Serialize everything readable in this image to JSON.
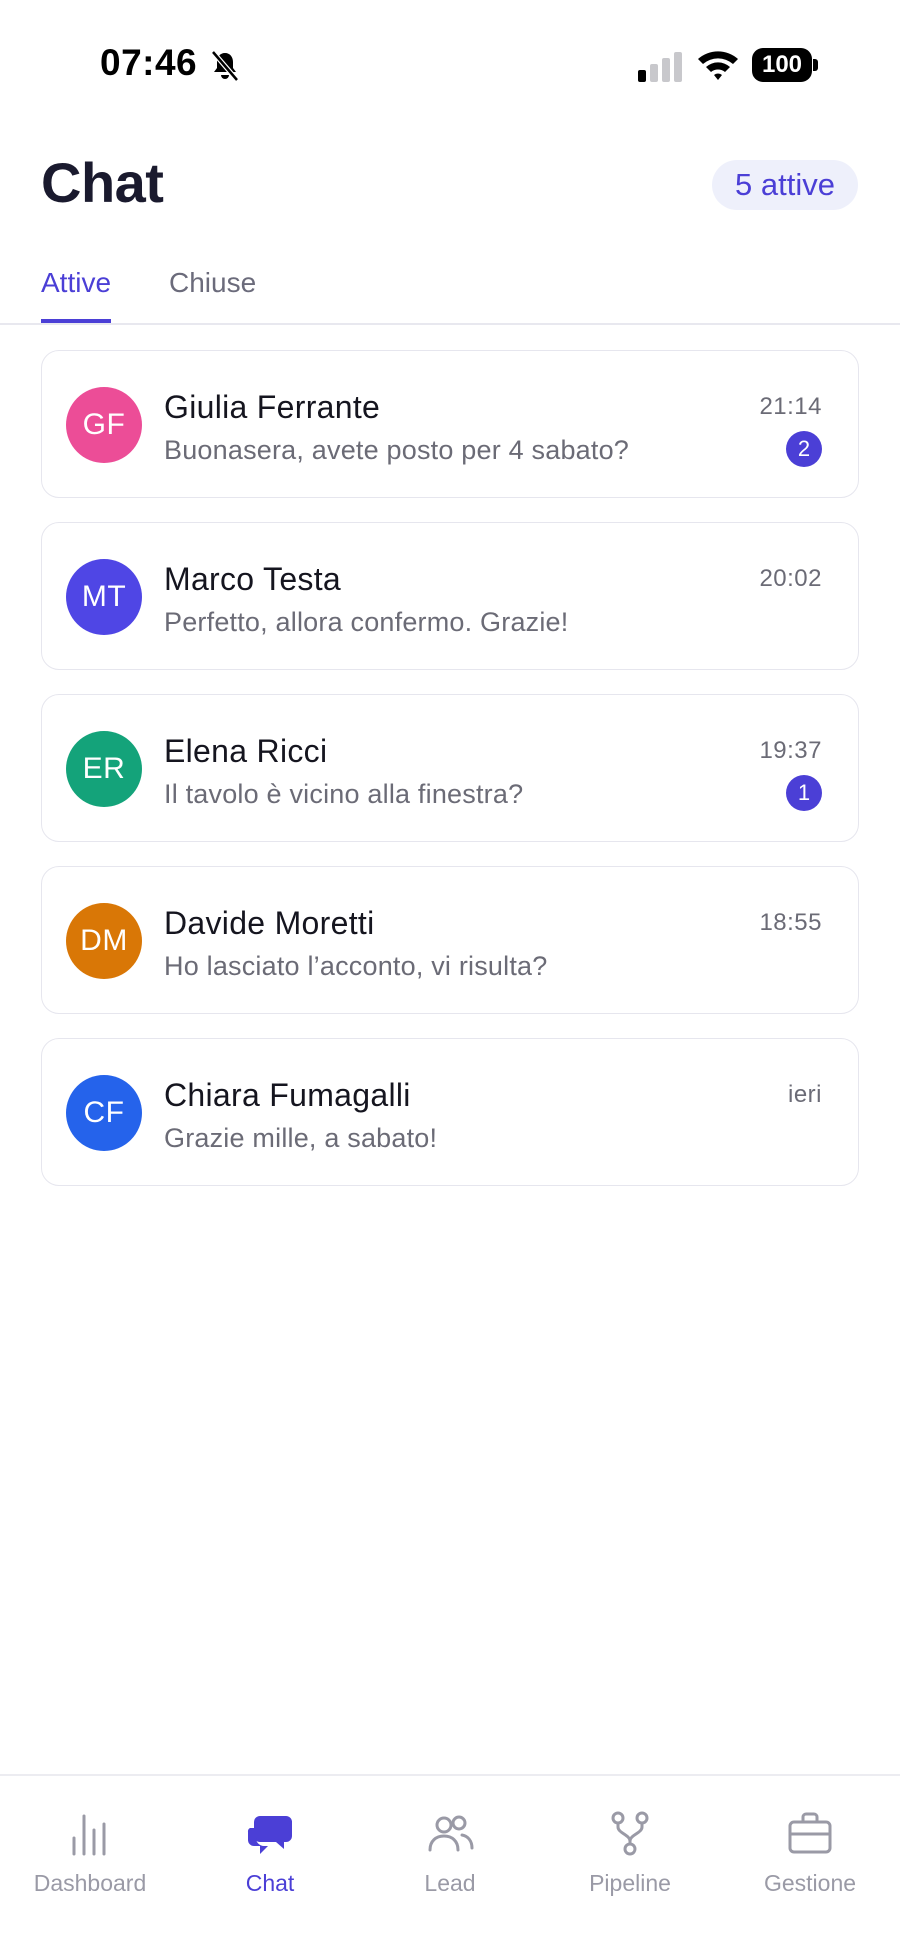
{
  "status_bar": {
    "time": "07:46",
    "battery": "100"
  },
  "header": {
    "title": "Chat",
    "active_pill": "5 attive"
  },
  "tabs": [
    {
      "label": "Attive",
      "active": true
    },
    {
      "label": "Chiuse",
      "active": false
    }
  ],
  "chats": [
    {
      "initials": "GF",
      "name": "Giulia Ferrante",
      "preview": "Buonasera, avete posto per 4 sabato?",
      "time": "21:14",
      "unread": "2",
      "avatar_color": "#ec4d97"
    },
    {
      "initials": "MT",
      "name": "Marco Testa",
      "preview": "Perfetto, allora confermo. Grazie!",
      "time": "20:02",
      "unread": "",
      "avatar_color": "#4f46e5"
    },
    {
      "initials": "ER",
      "name": "Elena Ricci",
      "preview": "Il tavolo è vicino alla finestra?",
      "time": "19:37",
      "unread": "1",
      "avatar_color": "#14a37a"
    },
    {
      "initials": "DM",
      "name": "Davide Moretti",
      "preview": "Ho lasciato l’acconto, vi risulta?",
      "time": "18:55",
      "unread": "",
      "avatar_color": "#d97706"
    },
    {
      "initials": "CF",
      "name": "Chiara Fumagalli",
      "preview": "Grazie mille, a sabato!",
      "time": "ieri",
      "unread": "",
      "avatar_color": "#2563eb"
    }
  ],
  "bottom_nav": [
    {
      "label": "Dashboard",
      "icon": "bar-chart-icon",
      "active": false
    },
    {
      "label": "Chat",
      "icon": "chat-bubbles-icon",
      "active": true
    },
    {
      "label": "Lead",
      "icon": "users-icon",
      "active": false
    },
    {
      "label": "Pipeline",
      "icon": "branch-icon",
      "active": false
    },
    {
      "label": "Gestione",
      "icon": "briefcase-icon",
      "active": false
    }
  ],
  "colors": {
    "accent": "#4b3fd6",
    "muted": "#6b6b76",
    "nav_inactive": "#9a9aa6"
  }
}
